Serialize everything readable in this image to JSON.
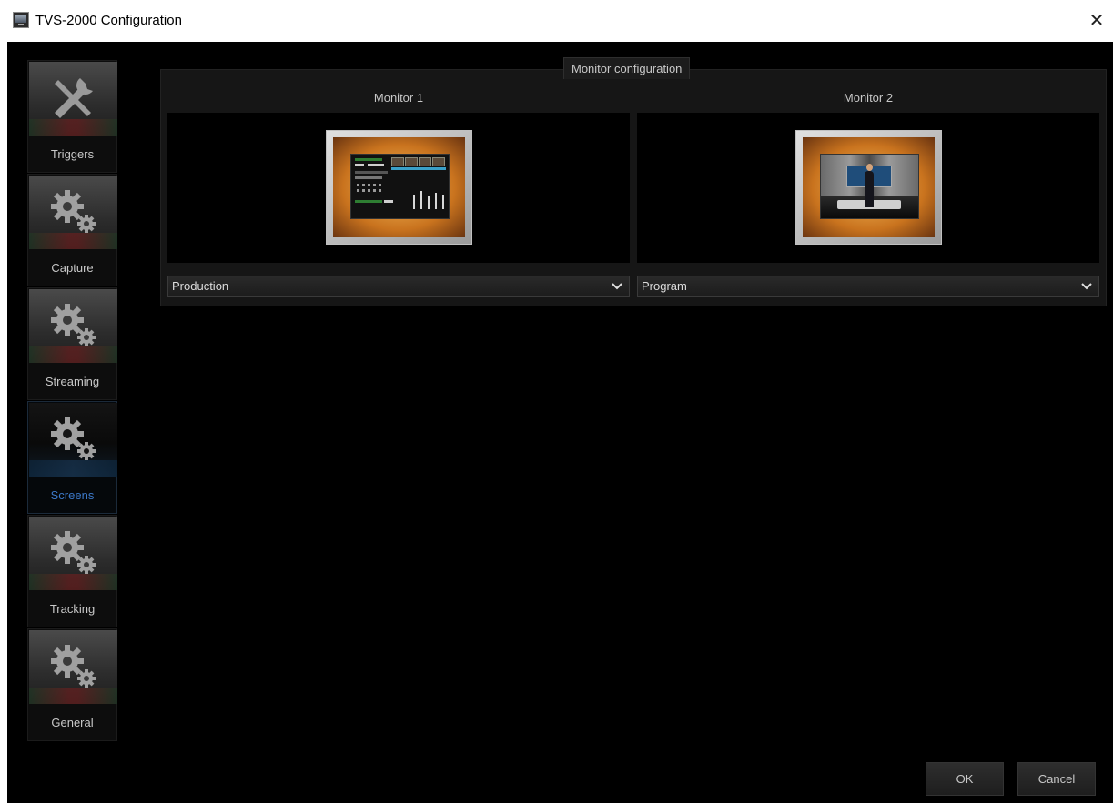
{
  "window": {
    "title": "TVS-2000 Configuration",
    "close_glyph": "✕"
  },
  "sidebar": {
    "items": [
      {
        "label": "Triggers",
        "icon": "tools-icon",
        "active": false
      },
      {
        "label": "Capture",
        "icon": "gears-icon",
        "active": false
      },
      {
        "label": "Streaming",
        "icon": "gears-icon",
        "active": false
      },
      {
        "label": "Screens",
        "icon": "gears-icon",
        "active": true
      },
      {
        "label": "Tracking",
        "icon": "gears-icon",
        "active": false
      },
      {
        "label": "General",
        "icon": "gears-icon",
        "active": false
      }
    ]
  },
  "panel": {
    "tab_label": "Monitor configuration",
    "monitors": [
      {
        "title": "Monitor 1",
        "selected": "Production"
      },
      {
        "title": "Monitor 2",
        "selected": "Program"
      }
    ]
  },
  "footer": {
    "ok_label": "OK",
    "cancel_label": "Cancel"
  },
  "colors": {
    "background": "#000000",
    "active_accent": "#3c78c8",
    "text": "#c8c8c8"
  }
}
